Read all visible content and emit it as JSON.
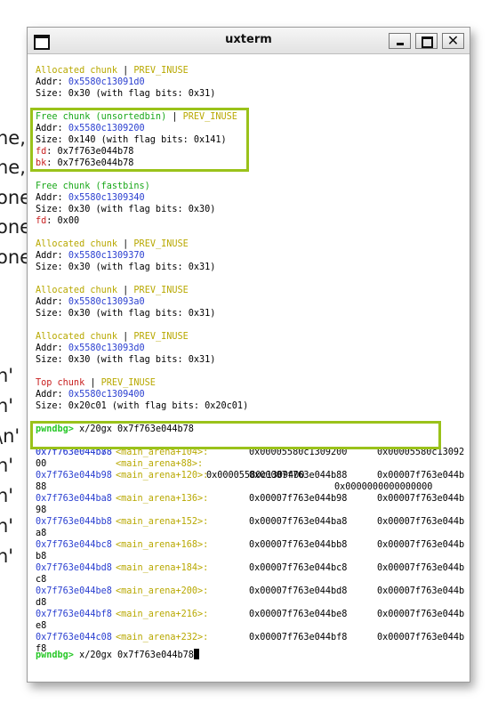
{
  "background_fragments": [
    "ne,",
    "ne,",
    "one",
    "one",
    "one",
    "n'",
    "n'",
    "\\n'",
    "n'",
    "n'",
    "n'",
    "n'"
  ],
  "window": {
    "title": "uxterm",
    "close_glyph": "✕"
  },
  "heap": [
    {
      "header": "Allocated chunk",
      "sep": " | ",
      "flag": "PREV_INUSE",
      "header_color": "yellow",
      "addr_label": "Addr:",
      "addr": "0x5580c13091d0",
      "size_line": "Size: 0x30 (with flag bits: 0x31)"
    },
    {
      "header": "Free chunk (unsortedbin)",
      "sep": " | ",
      "flag": "PREV_INUSE",
      "header_color": "green",
      "addr_label": "Addr:",
      "addr": "0x5580c1309200",
      "size_line": "Size: 0x140 (with flag bits: 0x141)",
      "fd_label": "fd",
      "fd": ": 0x7f763e044b78",
      "bk_label": "bk",
      "bk": ": 0x7f763e044b78"
    },
    {
      "header": "Free chunk (fastbins)",
      "header_color": "green",
      "addr_label": "Addr:",
      "addr": "0x5580c1309340",
      "size_line": "Size: 0x30 (with flag bits: 0x30)",
      "fd_label": "fd",
      "fd": ": 0x00"
    },
    {
      "header": "Allocated chunk",
      "sep": " | ",
      "flag": "PREV_INUSE",
      "header_color": "yellow",
      "addr_label": "Addr:",
      "addr": "0x5580c1309370",
      "size_line": "Size: 0x30 (with flag bits: 0x31)"
    },
    {
      "header": "Allocated chunk",
      "sep": " | ",
      "flag": "PREV_INUSE",
      "header_color": "yellow",
      "addr_label": "Addr:",
      "addr": "0x5580c13093a0",
      "size_line": "Size: 0x30 (with flag bits: 0x31)"
    },
    {
      "header": "Allocated chunk",
      "sep": " | ",
      "flag": "PREV_INUSE",
      "header_color": "yellow",
      "addr_label": "Addr:",
      "addr": "0x5580c13093d0",
      "size_line": "Size: 0x30 (with flag bits: 0x31)"
    },
    {
      "header": "Top chunk",
      "sep": " | ",
      "flag": "PREV_INUSE",
      "header_color": "red",
      "addr_label": "Addr:",
      "addr": "0x5580c1309400",
      "size_line": "Size: 0x20c01 (with flag bits: 0x20c01)"
    }
  ],
  "prompt": {
    "name": "pwndbg>",
    "command": " x/20gx 0x7f763e044b78"
  },
  "dump_first": {
    "addr": "0x7f763e044b78",
    "sym": "<main_arena+88>:",
    "v1": "0x00005580c1309400",
    "v2": "0x0000000000000000"
  },
  "dump": [
    {
      "addr": "0x7f763e044b88",
      "sym": "<main_arena+104>:",
      "v1": "0x00005580c1309200",
      "v2": "0x00005580c13092",
      "wrap": "00"
    },
    {
      "addr": "0x7f763e044b98",
      "sym": "<main_arena+120>:",
      "v1": "0x00007f763e044b88",
      "v2": "0x00007f763e044b",
      "wrap": "88"
    },
    {
      "addr": "0x7f763e044ba8",
      "sym": "<main_arena+136>:",
      "v1": "0x00007f763e044b98",
      "v2": "0x00007f763e044b",
      "wrap": "98"
    },
    {
      "addr": "0x7f763e044bb8",
      "sym": "<main_arena+152>:",
      "v1": "0x00007f763e044ba8",
      "v2": "0x00007f763e044b",
      "wrap": "a8"
    },
    {
      "addr": "0x7f763e044bc8",
      "sym": "<main_arena+168>:",
      "v1": "0x00007f763e044bb8",
      "v2": "0x00007f763e044b",
      "wrap": "b8"
    },
    {
      "addr": "0x7f763e044bd8",
      "sym": "<main_arena+184>:",
      "v1": "0x00007f763e044bc8",
      "v2": "0x00007f763e044b",
      "wrap": "c8"
    },
    {
      "addr": "0x7f763e044be8",
      "sym": "<main_arena+200>:",
      "v1": "0x00007f763e044bd8",
      "v2": "0x00007f763e044b",
      "wrap": "d8"
    },
    {
      "addr": "0x7f763e044bf8",
      "sym": "<main_arena+216>:",
      "v1": "0x00007f763e044be8",
      "v2": "0x00007f763e044b",
      "wrap": "e8"
    },
    {
      "addr": "0x7f763e044c08",
      "sym": "<main_arena+232>:",
      "v1": "0x00007f763e044bf8",
      "v2": "0x00007f763e044b",
      "wrap": "f8"
    }
  ],
  "input": {
    "prompt": "pwndbg>",
    "text": " x/20gx 0x7f763e044b78"
  },
  "colors": {
    "yellow": "#b8a800",
    "blue": "#2a3fd0",
    "green": "#1aa81a",
    "red": "#c81e1e",
    "highlight": "#9ac21a"
  }
}
